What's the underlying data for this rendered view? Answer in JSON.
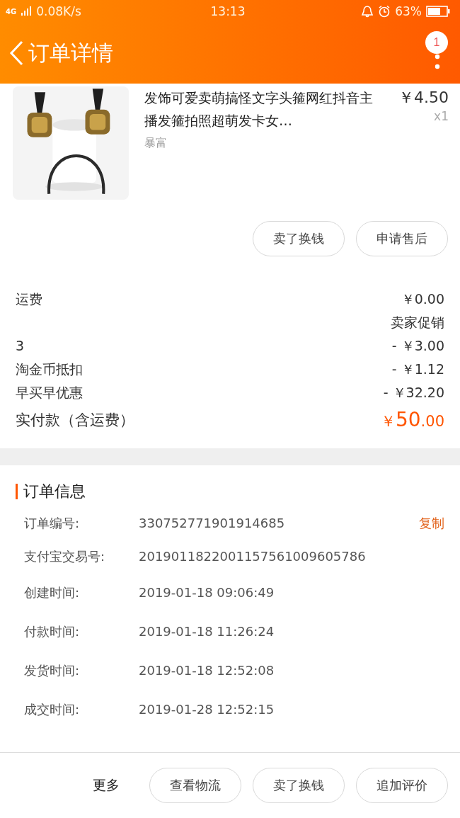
{
  "status_bar": {
    "network": "4G",
    "speed": "0.08K/s",
    "time": "13:13",
    "battery": "63%"
  },
  "header": {
    "title": "订单详情",
    "badge": "1"
  },
  "product": {
    "title": "发饰可爱卖萌搞怪文字头箍网红抖音主播发箍拍照超萌发卡女…",
    "sku": "暴富",
    "price": "￥4.50",
    "quantity": "x1"
  },
  "item_buttons": [
    "卖了换钱",
    "申请售后"
  ],
  "fees": [
    {
      "label": "运费",
      "value": "￥0.00"
    },
    {
      "value": "卖家促销"
    },
    {
      "label": "3",
      "value": "- ￥3.00"
    },
    {
      "label": "淘金币抵扣",
      "value": "- ￥1.12"
    },
    {
      "label": "早买早优惠",
      "value": "- ￥32.20"
    }
  ],
  "total": {
    "label": "实付款（含运费）",
    "currency": "￥",
    "amount": "50",
    "cents": ".00"
  },
  "order_info": {
    "title": "订单信息",
    "copy": "复制",
    "rows": [
      {
        "label": "订单编号:",
        "value": "330752771901914685"
      },
      {
        "label": "支付宝交易号:",
        "value": "2019011822001157561009605786"
      },
      {
        "label": "创建时间:",
        "value": "2019-01-18 09:06:49"
      },
      {
        "label": "付款时间:",
        "value": "2019-01-18 11:26:24"
      },
      {
        "label": "发货时间:",
        "value": "2019-01-18 12:52:08"
      },
      {
        "label": "成交时间:",
        "value": "2019-01-28 12:52:15"
      }
    ]
  },
  "bottom_bar": {
    "more": "更多",
    "buttons": [
      "查看物流",
      "卖了换钱",
      "追加评价"
    ]
  }
}
